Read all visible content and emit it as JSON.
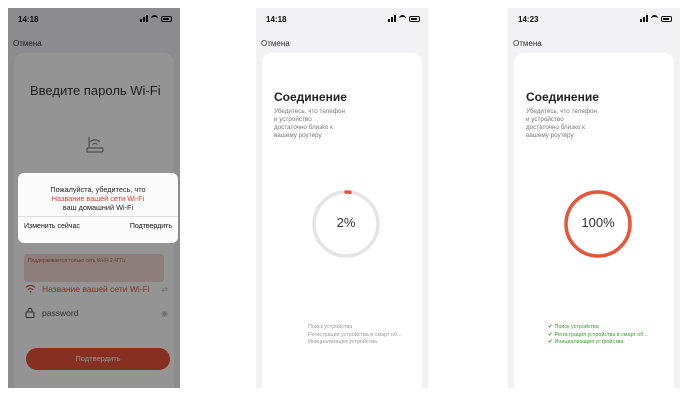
{
  "colors": {
    "accent": "#e8543a",
    "warning_text": "#d83a2a",
    "success": "#3a9a2a"
  },
  "screen1": {
    "time": "14:18",
    "cancel": "Отмена",
    "title": "Введите пароль Wi-Fi",
    "hint": "Поддерживается только сеть Wi-Fi 2,4ГГц",
    "wifi_name": "Название вашей сети Wi-Fi",
    "password": "password",
    "confirm_button": "Подтвердить",
    "dialog": {
      "line1": "Пожалуйста, убедитесь, что",
      "line2": "Название вашей сети Wi-Fi",
      "line3": "ваш домашний Wi-Fi",
      "change_now": "Изменить сейчас",
      "confirm": "Подтвердить"
    }
  },
  "screen2": {
    "time": "14:18",
    "cancel": "Отмена",
    "title": "Соединение",
    "desc1": "Убедитесь, что телефон",
    "desc2": "и устройство",
    "desc3": "достаточно близко к",
    "desc4": "вашему роутеру",
    "progress_label": "2%",
    "progress": 0.02,
    "steps": [
      "Поиск устройства",
      "Регистрация устройства в смарт об...",
      "Инициализация устройства"
    ]
  },
  "screen3": {
    "time": "14:23",
    "cancel": "Отмена",
    "title": "Соединение",
    "desc1": "Убедитесь, что телефон",
    "desc2": "и устройство",
    "desc3": "достаточно близко к",
    "desc4": "вашему роутеру",
    "progress_label": "100%",
    "progress": 1.0,
    "steps": [
      "Поиск устройства",
      "Регистрация устройства в смарт об...",
      "Инициализация устройства"
    ]
  }
}
